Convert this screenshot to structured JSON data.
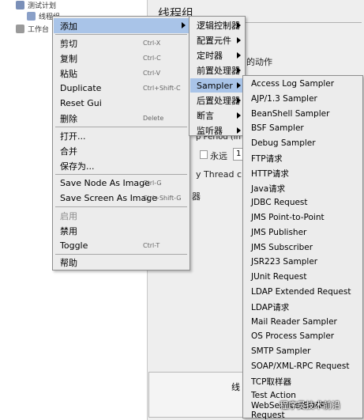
{
  "tree": {
    "plan_label": "测试计划",
    "thread_group_label": "线程组",
    "workbench_label": "工作台"
  },
  "right_panel": {
    "title": "线程组",
    "frag_action": "的动作",
    "frag_period": "p Period (in se",
    "frag_forever": "永远",
    "frag_forever_value": "1",
    "frag_thread_create": "y Thread creat",
    "frag_delay": "器",
    "frag_bottom": "线"
  },
  "context_menu": {
    "items": [
      {
        "label": "添加",
        "accel": "",
        "submenu": true,
        "selected": true,
        "disabled": false
      },
      {
        "label": "剪切",
        "accel": "Ctrl-X"
      },
      {
        "label": "复制",
        "accel": "Ctrl-C"
      },
      {
        "label": "粘贴",
        "accel": "Ctrl-V"
      },
      {
        "label": "Duplicate",
        "accel": "Ctrl+Shift-C"
      },
      {
        "label": "Reset Gui",
        "accel": ""
      },
      {
        "label": "删除",
        "accel": "Delete"
      },
      {
        "label": "打开...",
        "accel": ""
      },
      {
        "label": "合并",
        "accel": ""
      },
      {
        "label": "保存为...",
        "accel": ""
      },
      {
        "label": "Save Node As Image",
        "accel": "Ctrl-G"
      },
      {
        "label": "Save Screen As Image",
        "accel": "Ctrl+Shift-G"
      },
      {
        "label": "启用",
        "accel": "",
        "disabled": true
      },
      {
        "label": "禁用",
        "accel": ""
      },
      {
        "label": "Toggle",
        "accel": "Ctrl-T"
      },
      {
        "label": "帮助",
        "accel": ""
      }
    ]
  },
  "add_submenu": {
    "items": [
      "逻辑控制器",
      "配置元件",
      "定时器",
      "前置处理器",
      "Sampler",
      "后置处理器",
      "断言",
      "监听器"
    ]
  },
  "sampler_submenu": {
    "items": [
      "Access Log Sampler",
      "AJP/1.3 Sampler",
      "BeanShell Sampler",
      "BSF Sampler",
      "Debug Sampler",
      "FTP请求",
      "HTTP请求",
      "Java请求",
      "JDBC Request",
      "JMS Point-to-Point",
      "JMS Publisher",
      "JMS Subscriber",
      "JSR223 Sampler",
      "JUnit Request",
      "LDAP Extended Request",
      "LDAP请求",
      "Mail Reader Sampler",
      "OS Process Sampler",
      "SMTP Sampler",
      "SOAP/XML-RPC Request",
      "TCP取样器",
      "Test Action",
      "WebService(SOAP) Request"
    ]
  },
  "watermark": "程序员技术前沿",
  "colors": {
    "menu_bg": "#ececec",
    "selection": "#a9c4e8",
    "border": "#8e8e8e"
  }
}
